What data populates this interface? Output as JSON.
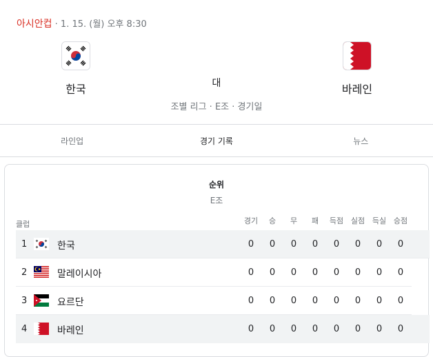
{
  "match": {
    "tournament": "아시안컵",
    "datetime": " · 1. 15. (월) 오후 8:30",
    "home_team": "한국",
    "away_team": "바레인",
    "vs_label": "대",
    "stage": "조별 리그 · E조 · 경기일",
    "home_flag": "south-korea-flag",
    "away_flag": "bahrain-flag"
  },
  "tabs": [
    {
      "label": "라인업",
      "active": false
    },
    {
      "label": "경기 기록",
      "active": true
    },
    {
      "label": "뉴스",
      "active": false
    }
  ],
  "standings": {
    "title": "순위",
    "group": "E조",
    "club_header": "클럽",
    "columns": [
      "경기",
      "승",
      "무",
      "패",
      "득점",
      "실점",
      "득실",
      "승점"
    ],
    "rows": [
      {
        "rank": "1",
        "team": "한국",
        "flag": "south-korea-flag",
        "highlight": true,
        "stats": [
          "0",
          "0",
          "0",
          "0",
          "0",
          "0",
          "0",
          "0"
        ]
      },
      {
        "rank": "2",
        "team": "말레이시아",
        "flag": "malaysia-flag",
        "highlight": false,
        "stats": [
          "0",
          "0",
          "0",
          "0",
          "0",
          "0",
          "0",
          "0"
        ]
      },
      {
        "rank": "3",
        "team": "요르단",
        "flag": "jordan-flag",
        "highlight": false,
        "stats": [
          "0",
          "0",
          "0",
          "0",
          "0",
          "0",
          "0",
          "0"
        ]
      },
      {
        "rank": "4",
        "team": "바레인",
        "flag": "bahrain-flag",
        "highlight": true,
        "stats": [
          "0",
          "0",
          "0",
          "0",
          "0",
          "0",
          "0",
          "0"
        ]
      }
    ]
  },
  "colors": {
    "tournament": "#d93025",
    "highlight_row": "#f1f3f4",
    "bahrain_red": "#ce1126"
  }
}
